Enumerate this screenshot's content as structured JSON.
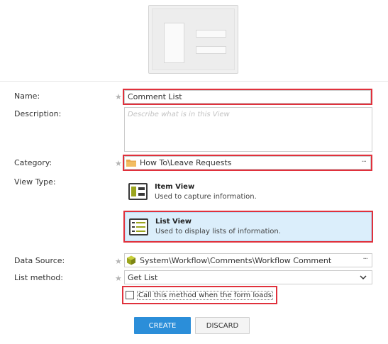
{
  "form": {
    "name_label": "Name:",
    "name_value": "Comment List",
    "description_label": "Description:",
    "description_placeholder": "Describe what is in this View",
    "category_label": "Category:",
    "category_value": "How To\\Leave Requests",
    "category_browse": "···",
    "view_type_label": "View Type:",
    "view_types": [
      {
        "title": "Item View",
        "desc": "Used to capture information."
      },
      {
        "title": "List View",
        "desc": "Used to display lists of information."
      }
    ],
    "data_source_label": "Data Source:",
    "data_source_value": "System\\Workflow\\Comments\\Workflow Comment",
    "data_source_browse": "···",
    "list_method_label": "List method:",
    "list_method_value": "Get List",
    "call_on_load_label": "Call this method when the form loads",
    "required_star": "★"
  },
  "buttons": {
    "create": "CREATE",
    "discard": "DISCARD"
  },
  "colors": {
    "accent": "#2b8ed9",
    "highlight": "#e0313c",
    "selected_bg": "#dbeefb",
    "icon_green": "#9ba51e"
  }
}
